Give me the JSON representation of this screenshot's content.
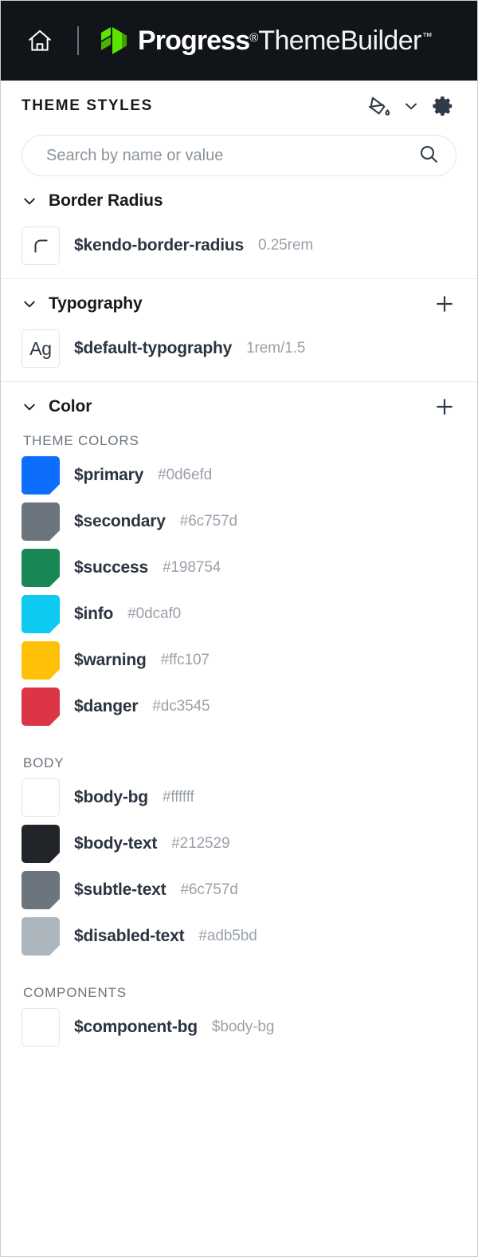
{
  "topbar": {
    "home_icon": "home-icon",
    "brand_name": "Progress",
    "brand_reg": "®",
    "brand_product": "ThemeBuilder",
    "brand_tm": "™"
  },
  "panel": {
    "title": "THEME STYLES",
    "actions": [
      {
        "name": "paint-bucket-icon",
        "label": "Paint"
      },
      {
        "name": "chevron-down-icon",
        "label": "More"
      },
      {
        "name": "gear-icon",
        "label": "Settings"
      }
    ]
  },
  "search": {
    "placeholder": "Search by name or value",
    "value": "",
    "icon": "search-icon"
  },
  "sections": [
    {
      "id": "border-radius",
      "name": "Border Radius",
      "expanded": true,
      "has_add": false,
      "items": [
        {
          "name": "$kendo-border-radius",
          "value": "0.25rem",
          "swatch": "radius-preview"
        }
      ]
    },
    {
      "id": "typography",
      "name": "Typography",
      "expanded": true,
      "has_add": true,
      "add_label": "+",
      "items": [
        {
          "name": "$default-typography",
          "value": "1rem/1.5",
          "swatch": "typography-preview",
          "swatch_text": "Ag"
        }
      ]
    },
    {
      "id": "color",
      "name": "Color",
      "expanded": true,
      "has_add": true,
      "add_label": "+",
      "groups": [
        {
          "label": "THEME COLORS",
          "items": [
            {
              "name": "$primary",
              "value": "#0d6efd",
              "color": "#0d6efd",
              "light": false
            },
            {
              "name": "$secondary",
              "value": "#6c757d",
              "color": "#6c757d",
              "light": false
            },
            {
              "name": "$success",
              "value": "#198754",
              "color": "#198754",
              "light": false
            },
            {
              "name": "$info",
              "value": "#0dcaf0",
              "color": "#0dcaf0",
              "light": false
            },
            {
              "name": "$warning",
              "value": "#ffc107",
              "color": "#ffc107",
              "light": false
            },
            {
              "name": "$danger",
              "value": "#dc3545",
              "color": "#dc3545",
              "light": false
            }
          ]
        },
        {
          "label": "BODY",
          "items": [
            {
              "name": "$body-bg",
              "value": "#ffffff",
              "color": "#ffffff",
              "light": true
            },
            {
              "name": "$body-text",
              "value": "#212529",
              "color": "#212529",
              "light": false
            },
            {
              "name": "$subtle-text",
              "value": "#6c757d",
              "color": "#6c757d",
              "light": false
            },
            {
              "name": "$disabled-text",
              "value": "#adb5bd",
              "color": "#adb5bd",
              "light": false
            }
          ]
        },
        {
          "label": "COMPONENTS",
          "items": [
            {
              "name": "$component-bg",
              "value": "$body-bg",
              "color": "#ffffff",
              "light": true
            }
          ]
        }
      ]
    }
  ]
}
